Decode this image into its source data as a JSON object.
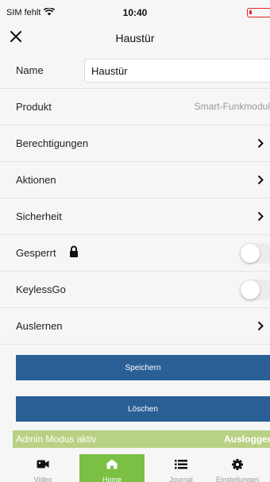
{
  "status_bar": {
    "carrier": "SIM fehlt",
    "time": "10:40"
  },
  "nav": {
    "title": "Haustür"
  },
  "rows": {
    "name": {
      "label": "Name",
      "value": "Haustür"
    },
    "produkt": {
      "label": "Produkt",
      "value": "Smart-Funkmodul"
    },
    "berechtigungen": {
      "label": "Berechtigungen"
    },
    "aktionen": {
      "label": "Aktionen"
    },
    "sicherheit": {
      "label": "Sicherheit"
    },
    "gesperrt": {
      "label": "Gesperrt",
      "toggle_on": false
    },
    "keylessgo": {
      "label": "KeylessGo",
      "toggle_on": false
    },
    "auslernen": {
      "label": "Auslernen"
    }
  },
  "buttons": {
    "save": "Speichern",
    "delete": "Löschen"
  },
  "admin": {
    "text": "Admin Modus aktiv",
    "logout": "Ausloggen"
  },
  "tabs": [
    {
      "label": "Video",
      "icon": "video-icon"
    },
    {
      "label": "Home",
      "icon": "home-icon",
      "active": true
    },
    {
      "label": "Journal",
      "icon": "list-icon"
    },
    {
      "label": "Einstellungen",
      "icon": "gear-icon"
    }
  ],
  "colors": {
    "primary_button": "#2a5f96",
    "admin_bar": "#b9d184",
    "active_tab": "#7cbf45",
    "battery": "#e22222"
  }
}
